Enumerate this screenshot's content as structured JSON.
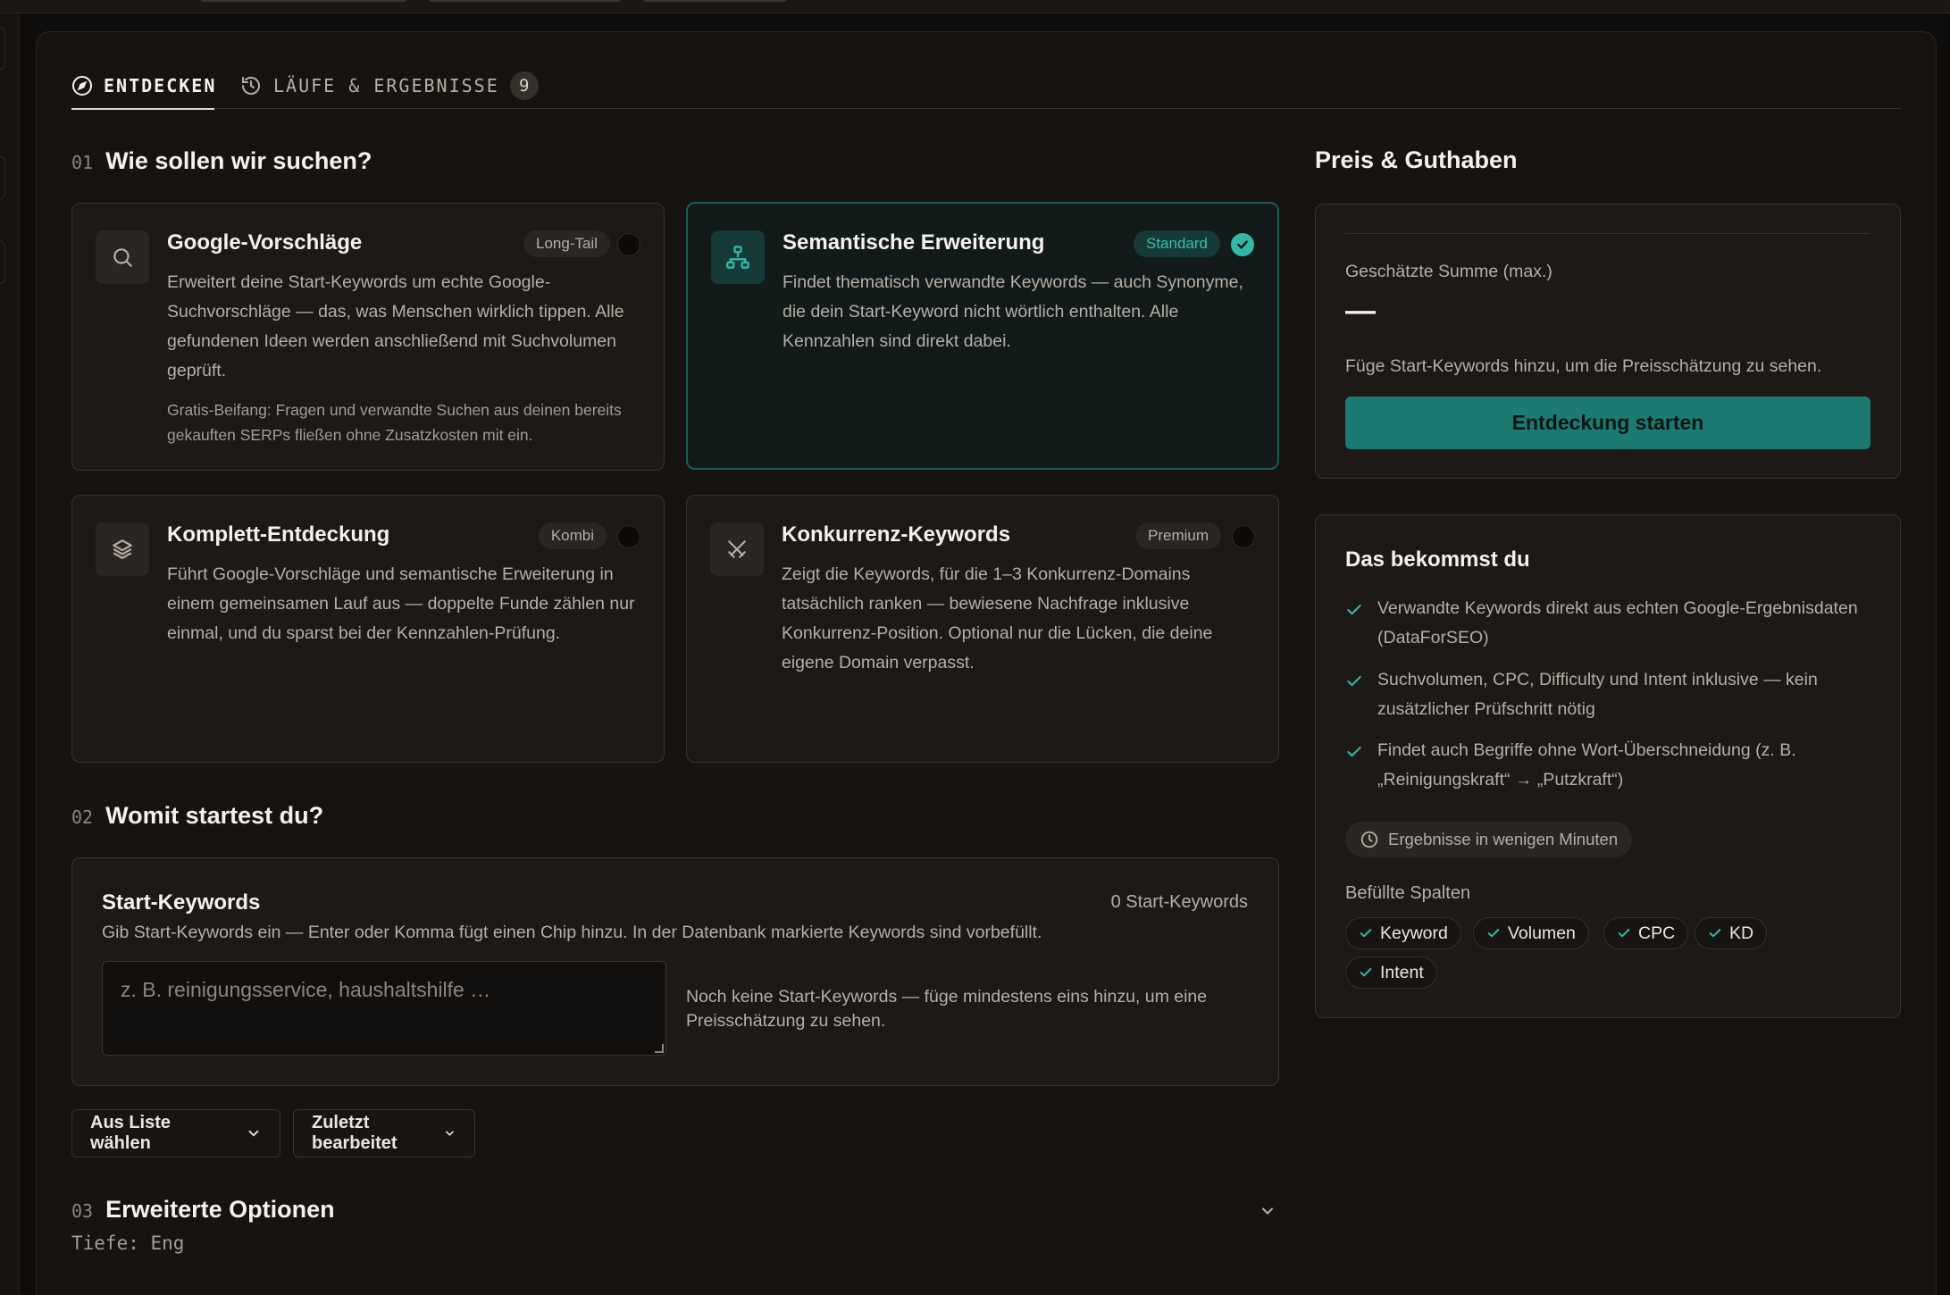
{
  "tabs": {
    "discover": "ENTDECKEN",
    "runs": "LÄUFE & ERGEBNISSE",
    "runs_count": "9"
  },
  "section1": {
    "num": "01",
    "title": "Wie sollen wir suchen?"
  },
  "methods": [
    {
      "title": "Google-Vorschläge",
      "badge": "Long-Tail",
      "selected": false,
      "icon": "search-icon",
      "desc": "Erweitert deine Start-Keywords um echte Google-Suchvorschläge — das, was Menschen wirklich tippen. Alle gefundenen Ideen werden anschließend mit Suchvolumen geprüft.",
      "note": "Gratis-Beifang: Fragen und verwandte Suchen aus deinen bereits gekauften SERPs fließen ohne Zusatzkosten mit ein."
    },
    {
      "title": "Semantische Erweiterung",
      "badge": "Standard",
      "selected": true,
      "icon": "network-icon",
      "desc": "Findet thematisch verwandte Keywords — auch Synonyme, die dein Start-Keyword nicht wörtlich enthalten. Alle Kennzahlen sind direkt dabei."
    },
    {
      "title": "Komplett-Entdeckung",
      "badge": "Kombi",
      "selected": false,
      "icon": "layers-icon",
      "desc": "Führt Google-Vorschläge und semantische Erweiterung in einem gemeinsamen Lauf aus — doppelte Funde zählen nur einmal, und du sparst bei der Kennzahlen-Prüfung."
    },
    {
      "title": "Konkurrenz-Keywords",
      "badge": "Premium",
      "selected": false,
      "icon": "swords-icon",
      "desc": "Zeigt die Keywords, für die 1–3 Konkurrenz-Domains tatsächlich ranken — bewiesene Nachfrage inklusive Konkurrenz-Position. Optional nur die Lücken, die deine eigene Domain verpasst."
    }
  ],
  "section2": {
    "num": "02",
    "title": "Womit startest du?"
  },
  "keywords": {
    "title": "Start-Keywords",
    "count": "0 Start-Keywords",
    "help": "Gib Start-Keywords ein — Enter oder Komma fügt einen Chip hinzu. In der Datenbank markierte Keywords sind vorbefüllt.",
    "placeholder": "z. B. reinigungsservice, haushaltshilfe …",
    "empty": "Noch keine Start-Keywords — füge mindestens eins hinzu, um eine Preisschätzung zu sehen."
  },
  "buttons": {
    "from_list": "Aus Liste wählen",
    "recent": "Zuletzt bearbeitet"
  },
  "section3": {
    "num": "03",
    "title": "Erweiterte Optionen",
    "depth": "Tiefe: Eng"
  },
  "price": {
    "title": "Preis & Guthaben",
    "label": "Geschätzte Summe (max.)",
    "value": "—",
    "hint": "Füge Start-Keywords hinzu, um die Preisschätzung zu sehen.",
    "start": "Entdeckung starten"
  },
  "benefits": {
    "title": "Das bekommst du",
    "items": [
      "Verwandte Keywords direkt aus echten Google-Ergebnisdaten (DataForSEO)",
      "Suchvolumen, CPC, Difficulty und Intent inklusive — kein zusätzlicher Prüfschritt nötig",
      "Findet auch Begriffe ohne Wort-Überschneidung (z. B. „Reinigungskraft“ → „Putzkraft“)"
    ],
    "time": "Ergebnisse in wenigen Minuten",
    "cols_label": "Befüllte Spalten",
    "cols": [
      "Keyword",
      "Volumen",
      "CPC",
      "KD",
      "Intent"
    ]
  },
  "colors": {
    "accent": "#35b7a8",
    "button": "#1c7a72",
    "background": "#0f0d0c",
    "panel": "#1c1917"
  }
}
